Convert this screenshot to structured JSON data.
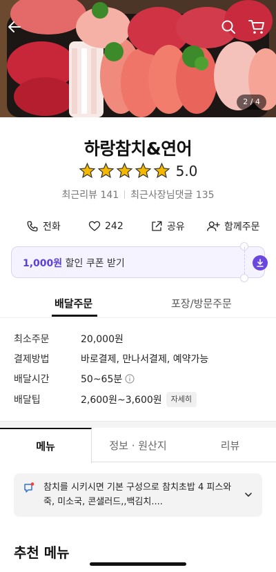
{
  "hero": {
    "page_indicator": "2 / 4",
    "icons": [
      "back-arrow-icon",
      "search-icon",
      "cart-icon"
    ]
  },
  "store": {
    "name": "하랑참치&연어",
    "rating": "5.0",
    "stars": 5,
    "recent_reviews": "최근리뷰 141",
    "owner_replies": "최근사장님댓글 135"
  },
  "actions": {
    "call": "전화",
    "likes": "242",
    "share": "공유",
    "group_order": "함께주문"
  },
  "coupon": {
    "amount": "1,000원",
    "text": " 할인 쿠폰 받기"
  },
  "order_tabs": {
    "delivery": "배달주문",
    "pickup": "포장/방문주문"
  },
  "info": {
    "min_order_label": "최소주문",
    "min_order_value": "20,000원",
    "payment_label": "결제방법",
    "payment_value": "바로결제, 만나서결제, 예약가능",
    "delivery_time_label": "배달시간",
    "delivery_time_value": "50~65분",
    "delivery_tip_label": "배달팁",
    "delivery_tip_value": "2,600원~3,600원",
    "detail_button": "자세히"
  },
  "menu_tabs": {
    "menu": "메뉴",
    "info": "정보 · 원산지",
    "review": "리뷰"
  },
  "notice": {
    "text": "참치를 시키시면 기본 구성으로  참치초밥  4 피스와  죽, 미소국, 콘샐러드,,백김치...."
  },
  "section": {
    "recommended": "추천 메뉴"
  },
  "colors": {
    "accent": "#6a48e0",
    "star": "#f5b800"
  }
}
